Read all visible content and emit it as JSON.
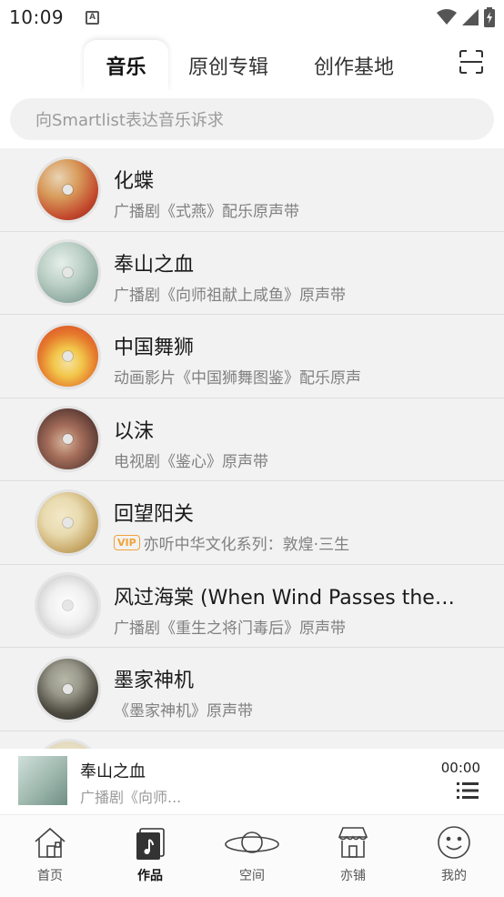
{
  "status_bar": {
    "time": "10:09",
    "notification_letter": "A"
  },
  "top_tabs": [
    {
      "label": "音乐",
      "active": true
    },
    {
      "label": "原创专辑",
      "active": false
    },
    {
      "label": "创作基地",
      "active": false
    }
  ],
  "search": {
    "placeholder": "向Smartlist表达音乐诉求"
  },
  "albums": [
    {
      "title": "化蝶",
      "subtitle": "广播剧《式燕》配乐原声带",
      "vip": false,
      "colors": [
        "#e8d4b4",
        "#c2472c",
        "#f0c66e"
      ]
    },
    {
      "title": "奉山之血",
      "subtitle": "广播剧《向师祖献上咸鱼》原声带",
      "vip": false,
      "colors": [
        "#d8e6df",
        "#9fb9ae",
        "#6d8d83"
      ]
    },
    {
      "title": "中国舞狮",
      "subtitle": "动画影片《中国狮舞图鉴》配乐原声",
      "vip": false,
      "colors": [
        "#f2c64a",
        "#d9402a",
        "#f5e3a3"
      ]
    },
    {
      "title": "以沫",
      "subtitle": "电视剧《鉴心》原声带",
      "vip": false,
      "colors": [
        "#5a3a33",
        "#a46d5a",
        "#d8b59c"
      ]
    },
    {
      "title": "回望阳关",
      "subtitle": "亦听中华文化系列：敦煌·三生",
      "vip": true,
      "vip_label": "VIP",
      "colors": [
        "#e9dbb0",
        "#c6a664",
        "#8a7a50"
      ]
    },
    {
      "title": "风过海棠 (When Wind Passes the ...",
      "subtitle": "广播剧《重生之将门毒后》原声带",
      "vip": false,
      "colors": [
        "#f4f4f4",
        "#cfcfcf",
        "#3a3a3a"
      ]
    },
    {
      "title": "墨家神机",
      "subtitle": "《墨家神机》原声带",
      "vip": false,
      "colors": [
        "#9a9a8c",
        "#4d4a40",
        "#2a2a26"
      ]
    }
  ],
  "player": {
    "title": "奉山之血",
    "subtitle": "广播剧《向师...",
    "time": "00:00"
  },
  "bottom_nav": [
    {
      "label": "首页",
      "icon": "house-icon",
      "active": false
    },
    {
      "label": "作品",
      "icon": "music-note-icon",
      "active": true
    },
    {
      "label": "空间",
      "icon": "planet-icon",
      "active": false
    },
    {
      "label": "亦铺",
      "icon": "shop-icon",
      "active": false
    },
    {
      "label": "我的",
      "icon": "smiley-icon",
      "active": false
    }
  ],
  "colors": {
    "accent_vip": "#f0a23a",
    "list_bg": "#f2f2f2",
    "search_bg": "#f1f1f1"
  }
}
